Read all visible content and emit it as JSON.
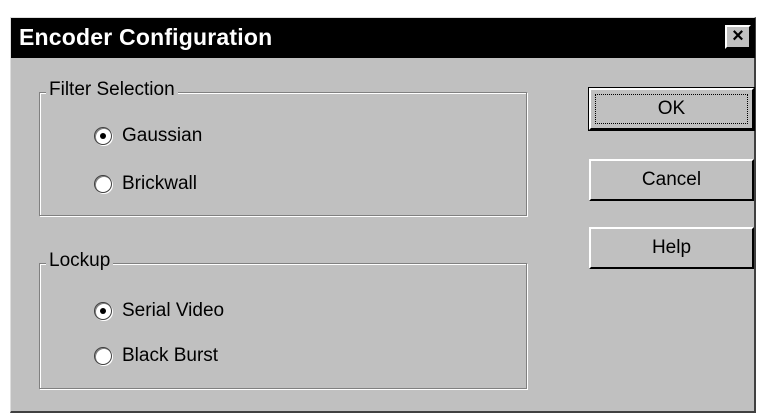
{
  "window": {
    "title": "Encoder Configuration",
    "close_label": "×"
  },
  "filter_selection": {
    "legend": "Filter Selection",
    "options": [
      {
        "label": "Gaussian",
        "selected": true
      },
      {
        "label": "Brickwall",
        "selected": false
      }
    ]
  },
  "lockup": {
    "legend": "Lockup",
    "options": [
      {
        "label": "Serial Video",
        "selected": true
      },
      {
        "label": "Black Burst",
        "selected": false
      }
    ]
  },
  "buttons": {
    "ok": "OK",
    "cancel": "Cancel",
    "help": "Help"
  }
}
